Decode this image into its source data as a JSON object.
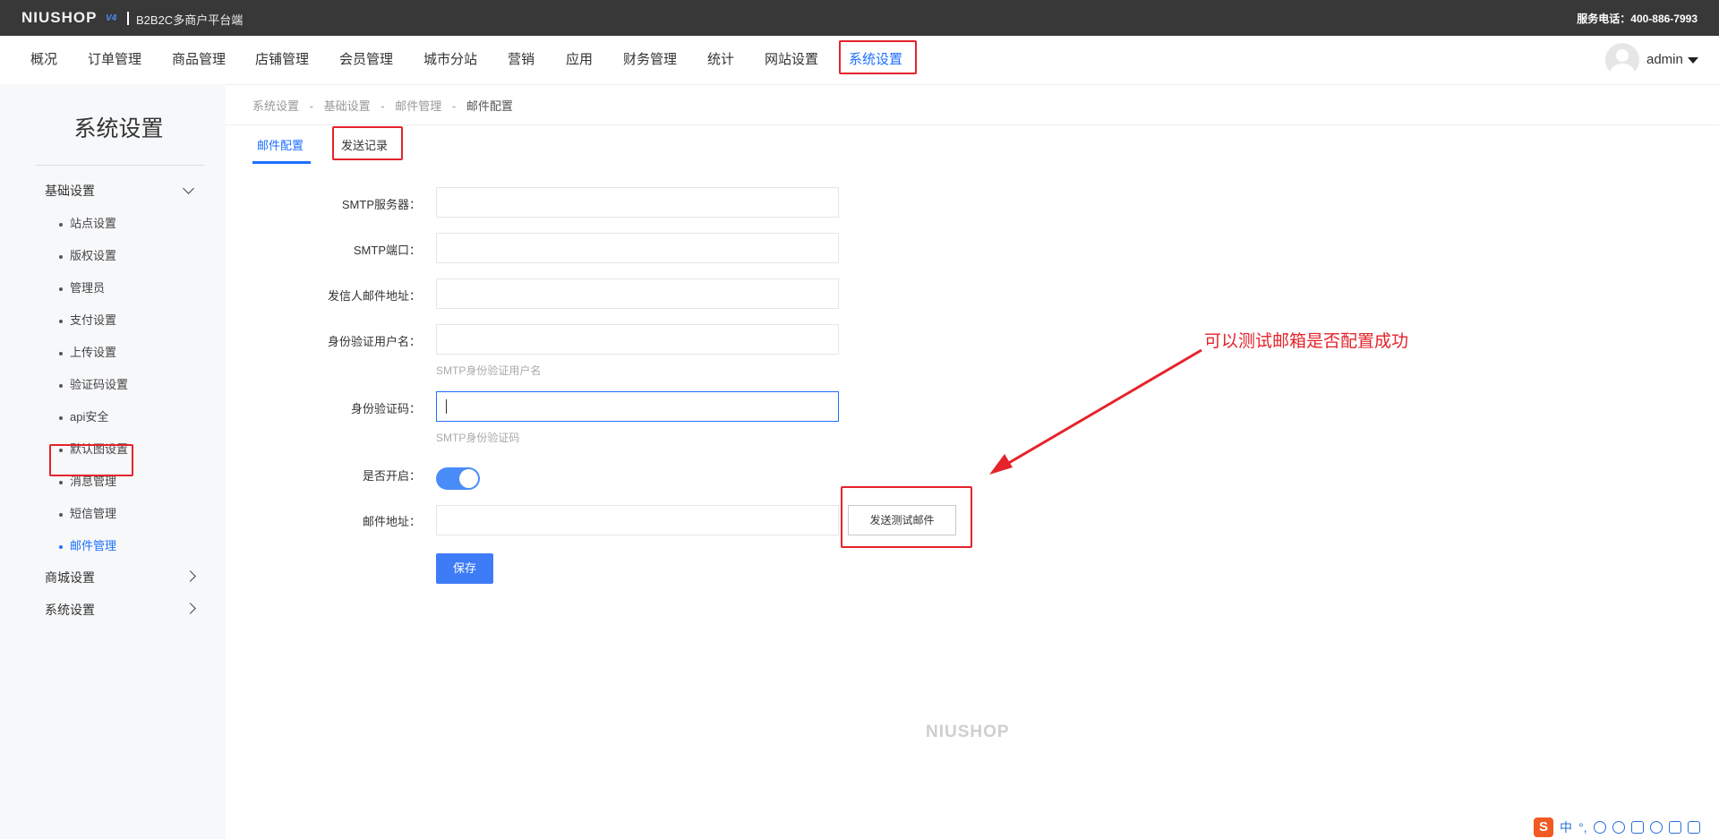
{
  "header": {
    "logo": "NIUSHOP",
    "logo_version": "V4",
    "subtitle": "B2B2C多商户平台端",
    "service_phone": "服务电话：400-886-7993"
  },
  "main_nav": {
    "items": [
      "概况",
      "订单管理",
      "商品管理",
      "店铺管理",
      "会员管理",
      "城市分站",
      "营销",
      "应用",
      "财务管理",
      "统计",
      "网站设置",
      "系统设置"
    ],
    "active": "系统设置"
  },
  "user": {
    "name": "admin"
  },
  "sidebar": {
    "title": "系统设置",
    "groups": [
      {
        "label": "基础设置",
        "expanded": true,
        "items": [
          "站点设置",
          "版权设置",
          "管理员",
          "支付设置",
          "上传设置",
          "验证码设置",
          "api安全",
          "默认图设置",
          "消息管理",
          "短信管理",
          "邮件管理"
        ],
        "active": "邮件管理"
      },
      {
        "label": "商城设置",
        "expanded": false
      },
      {
        "label": "系统设置",
        "expanded": false
      }
    ]
  },
  "breadcrumb": [
    "系统设置",
    "-",
    "基础设置",
    "-",
    "邮件管理",
    "-",
    "邮件配置"
  ],
  "tabs": [
    {
      "label": "邮件配置",
      "active": true
    },
    {
      "label": "发送记录",
      "active": false
    }
  ],
  "form": {
    "smtp_server": {
      "label": "SMTP服务器：",
      "value": ""
    },
    "smtp_port": {
      "label": "SMTP端口：",
      "value": ""
    },
    "sender_email": {
      "label": "发信人邮件地址：",
      "value": ""
    },
    "auth_username": {
      "label": "身份验证用户名：",
      "value": "",
      "hint": "SMTP身份验证用户名"
    },
    "auth_code": {
      "label": "身份验证码：",
      "value": "",
      "hint": "SMTP身份验证码"
    },
    "enabled": {
      "label": "是否开启：",
      "on": true
    },
    "test_email": {
      "label": "邮件地址：",
      "value": ""
    },
    "send_test_button": "发送测试邮件",
    "save_button": "保存"
  },
  "annotation": "可以测试邮箱是否配置成功",
  "footer_logo": "NIUSHOP",
  "ime_tray": {
    "logo": "S",
    "mode": "中",
    "punct": "°,"
  },
  "colors": {
    "accent": "#1e6fff",
    "highlight_box": "#e4232b",
    "topbar": "#383838",
    "sidebar_bg": "#f7f8fa"
  }
}
